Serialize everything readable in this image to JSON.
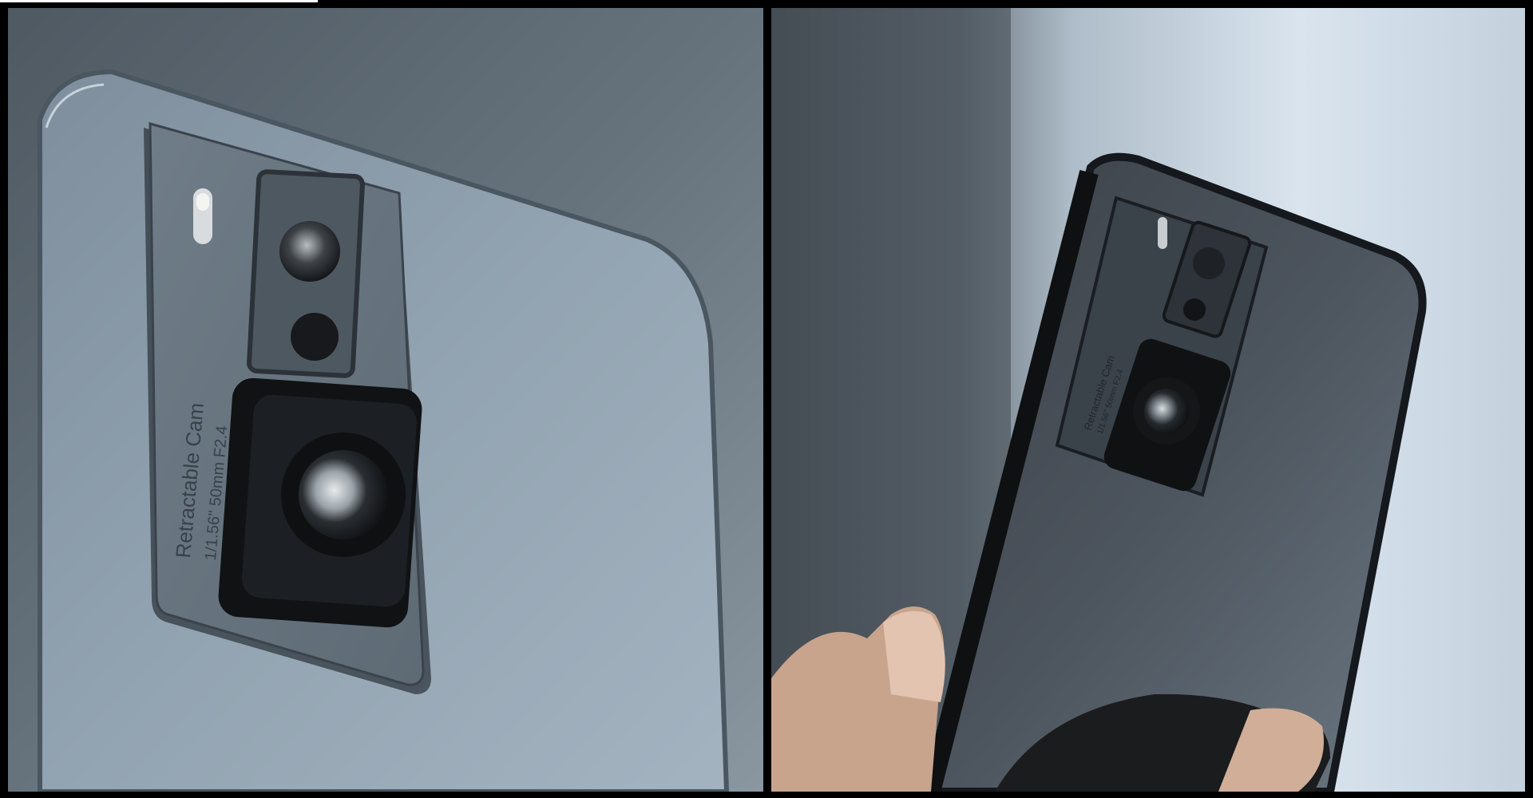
{
  "left_panel": {
    "camera_label": {
      "line1": "Retractable Cam",
      "line2": "1/1.56\"  50mm  F2.4"
    }
  },
  "right_panel": {
    "camera_label": {
      "line1": "Retractable Cam",
      "line2": "1/1.56\"  50mm  F2.4"
    }
  },
  "colors": {
    "left_background": "#5d6a74",
    "phone_body": "#8898a6",
    "camera_module": "#6d7a85",
    "lens_black": "#17191c",
    "right_background": "#c9d6e2"
  }
}
